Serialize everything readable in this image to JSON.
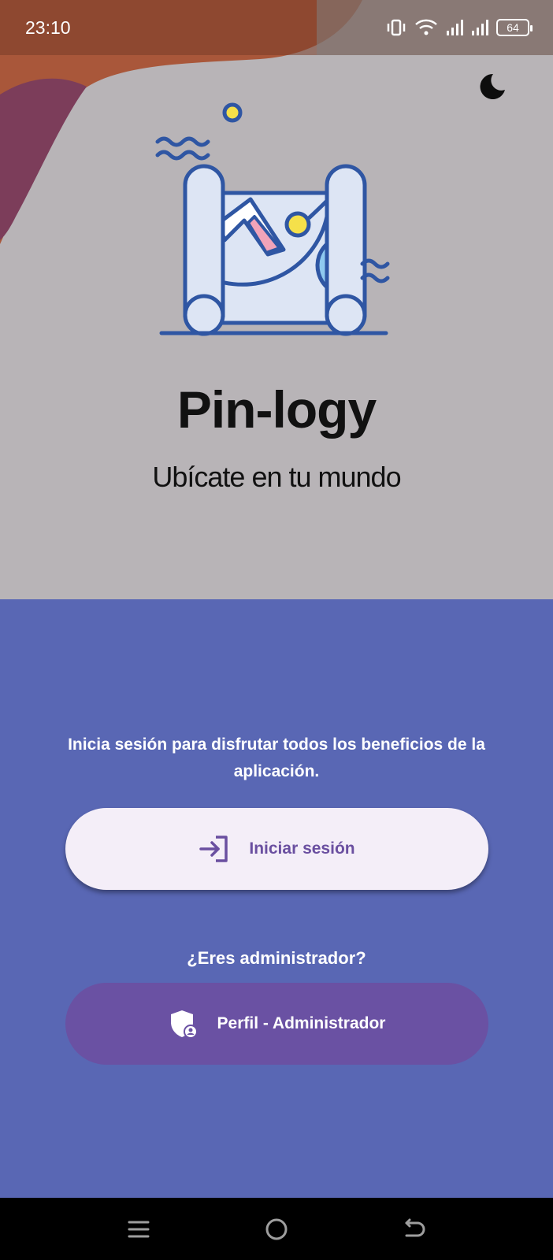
{
  "status_bar": {
    "time": "23:10",
    "battery_level": "64",
    "icons": [
      "vibrate-icon",
      "wifi-icon",
      "signal-icon",
      "signal-icon",
      "battery-icon"
    ]
  },
  "header": {
    "theme_toggle_icon": "moon-icon"
  },
  "hero": {
    "title": "Pin-logy",
    "subtitle": "Ubícate en tu mundo",
    "illustration": "map-scroll-illustration"
  },
  "main": {
    "prompt": "Inicia sesión para disfrutar todos los beneficios de la aplicación.",
    "login_button": {
      "label": "Iniciar sesión",
      "icon": "login-icon"
    },
    "admin_question": "¿Eres administrador?",
    "admin_button": {
      "label": "Perfil - Administrador",
      "icon": "admin-shield-icon"
    }
  },
  "nav_bar": {
    "items": [
      "menu-icon",
      "home-icon",
      "back-icon"
    ]
  },
  "colors": {
    "top_background": "#b8b4b7",
    "bottom_background": "#5967b4",
    "login_button_bg": "#f4eef8",
    "login_button_text": "#6a4fa0",
    "admin_button_bg": "#6a51a3",
    "illustration_stroke": "#2f56a3"
  }
}
